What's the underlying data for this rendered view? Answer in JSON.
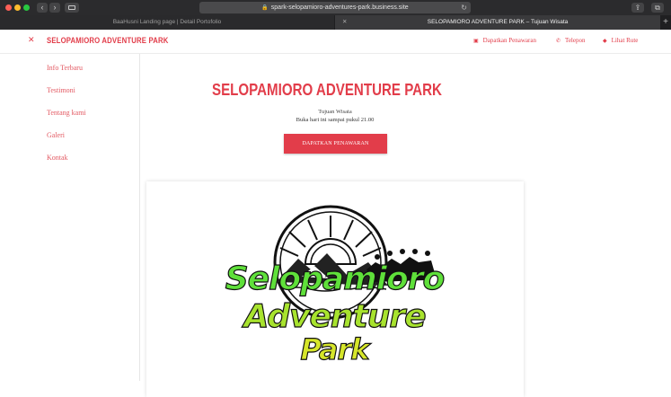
{
  "browser": {
    "url": "spark-selopamioro-adventures-park.business.site",
    "tabs": [
      {
        "label": "BaaHusni Landing page | Detail Portofolio",
        "active": false
      },
      {
        "label": "SELOPAMIORO ADVENTURE PARK – Tujuan Wisata",
        "active": true
      }
    ]
  },
  "header": {
    "title": "SELOPAMIORO ADVENTURE PARK",
    "links": [
      {
        "label": "Dapatkan Penawaran",
        "icon": "tag-icon"
      },
      {
        "label": "Telepon",
        "icon": "phone-icon"
      },
      {
        "label": "Lihat Rute",
        "icon": "directions-icon"
      }
    ]
  },
  "nav": {
    "items": [
      "Info Terbaru",
      "Testimoni",
      "Tentang kami",
      "Galeri",
      "Kontak"
    ]
  },
  "hero": {
    "title": "SELOPAMIORO ADVENTURE PARK",
    "category": "Tujuan Wisata",
    "hours": "Buka hari ini sampai pukul 21.00",
    "cta_label": "DAPATKAN PENAWARAN"
  },
  "logo": {
    "line1": "Selopamioro",
    "line2": "Adventure",
    "line3": "Park"
  },
  "colors": {
    "accent": "#e23d4a",
    "chrome": "#2b2b2d"
  }
}
